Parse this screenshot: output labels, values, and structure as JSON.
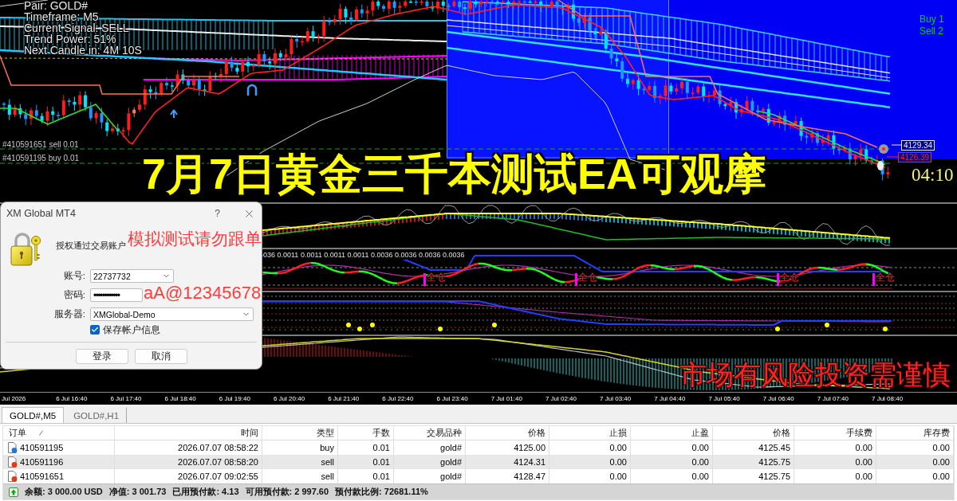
{
  "chart": {
    "info_lines": [
      "Pair: GOLD#",
      "Timeframe: M5",
      "Current Signal: SELL",
      "Trend Power: 51%",
      "Next Candle in: 4M 10S"
    ],
    "order_labels": [
      "#410591651 sell 0.01",
      "#410591195 buy 0.01"
    ],
    "signal_counts": [
      "Buy 1",
      "Sell 2"
    ],
    "price_tags": [
      {
        "text": "4129.34",
        "color": "#e8e8ff"
      },
      {
        "text": "4126.39",
        "color": "#ff2020"
      }
    ],
    "countdown": "04:10",
    "indicator_values": "036 0.0011 0.0011 0.0011 0.0011 0.0036 0.0036 0.0036 0.0036",
    "position_labels": [
      "全仓",
      "全仓",
      "全仓",
      "全仓"
    ],
    "time_axis": [
      "Jul 2026",
      "6 Jul 16:40",
      "6 Jul 17:40",
      "6 Jul 18:40",
      "6 Jul 19:40",
      "6 Jul 20:40",
      "6 Jul 21:40",
      "6 Jul 22:40",
      "6 Jul 23:40",
      "7 Jul 01:40",
      "7 Jul 02:40",
      "7 Jul 03:40",
      "7 Jul 04:40",
      "7 Jul 05:40",
      "7 Jul 06:40",
      "7 Jul 07:40",
      "7 Jul 08:40"
    ]
  },
  "overlays": [
    {
      "kind": "headline",
      "text": "7月7日黄金三千本测试EA可观摩"
    },
    {
      "kind": "prompt_note",
      "text": "模拟测试请勿跟单"
    },
    {
      "kind": "password_note",
      "text": "aA@12345678"
    },
    {
      "kind": "risk_note",
      "text": "市场有风险投资需谨慎"
    }
  ],
  "login_dialog": {
    "title": "XM Global MT4",
    "help": "?",
    "prompt": "授权通过交易账户",
    "fields": [
      {
        "kind": "combo",
        "label": "账号:",
        "value": "22737732"
      },
      {
        "kind": "password",
        "label": "密码:",
        "value": "••••••••••••"
      },
      {
        "kind": "combo",
        "label": "服务器:",
        "value": "XMGlobal-Demo"
      }
    ],
    "save_info": {
      "label": "保存帐户信息",
      "checked": true
    },
    "buttons": [
      "登录",
      "取消"
    ]
  },
  "tabs": [
    {
      "label": "GOLD#,M5",
      "selected": true
    },
    {
      "label": "GOLD#,H1",
      "selected": false
    }
  ],
  "trade_table": {
    "columns": [
      "订单",
      "时间",
      "类型",
      "手数",
      "交易品种",
      "价格",
      "止损",
      "止盈",
      "价格",
      "手续费",
      "库存费"
    ],
    "rows": [
      {
        "kind": "buy",
        "cells": [
          "410591195",
          "2026.07.07 08:58:22",
          "buy",
          "0.01",
          "gold#",
          "4125.00",
          "0.00",
          "0.00",
          "4125.45",
          "0.00",
          "0.00"
        ]
      },
      {
        "kind": "sell",
        "cells": [
          "410591196",
          "2026.07.07 08:58:20",
          "sell",
          "0.01",
          "gold#",
          "4124.31",
          "0.00",
          "0.00",
          "4125.75",
          "0.00",
          "0.00"
        ]
      },
      {
        "kind": "sell",
        "cells": [
          "410591651",
          "2026.07.07 09:02:55",
          "sell",
          "0.01",
          "gold#",
          "4128.47",
          "0.00",
          "0.00",
          "4125.75",
          "0.00",
          "0.00"
        ]
      }
    ],
    "summary": [
      "余额: 3 000.00 USD",
      "净值: 3 001.73",
      "已用预付款: 4.13",
      "可用预付款: 2 997.60",
      "预付款比例: 72681.11%"
    ]
  }
}
